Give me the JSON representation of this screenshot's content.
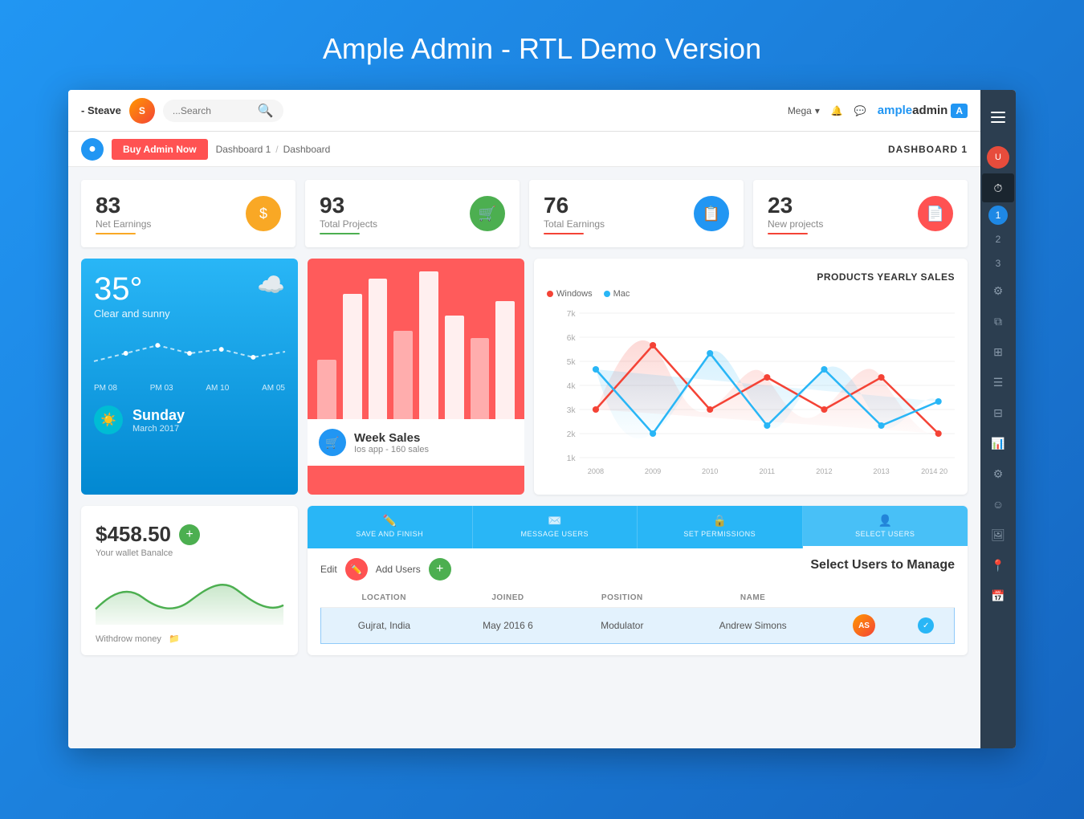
{
  "page": {
    "title": "Ample Admin - RTL Demo Version"
  },
  "header": {
    "brand": "- Steave",
    "search_placeholder": "...Search",
    "mega_label": "Mega",
    "logo_text_prefix": "ample",
    "logo_text_suffix": "admin"
  },
  "toolbar": {
    "buy_btn": "Buy Admin Now",
    "breadcrumb": [
      "Dashboard 1",
      "Dashboard"
    ],
    "dashboard_label": "DASHBOARD 1"
  },
  "stats": [
    {
      "number": "83",
      "label": "Net Earnings",
      "color": "#f9a825",
      "icon": "$",
      "underline": "#f9a825"
    },
    {
      "number": "93",
      "label": "Total Projects",
      "color": "#4caf50",
      "icon": "🛒",
      "underline": "#4caf50"
    },
    {
      "number": "76",
      "label": "Total Earnings",
      "color": "#2196F3",
      "icon": "📋",
      "underline": "#f44336"
    },
    {
      "number": "23",
      "label": "New projects",
      "color": "#ff5252",
      "icon": "📄",
      "underline": "#f44336"
    }
  ],
  "weather": {
    "temp": "35°",
    "icon": "☁️",
    "desc": "Clear and sunny",
    "times": [
      "PM 08",
      "PM 03",
      "AM 10",
      "AM 05"
    ],
    "day": "Sunday",
    "month": "March 2017"
  },
  "week_sales": {
    "title": "Week Sales",
    "subtitle": "Ios app - 160 sales",
    "bars": [
      40,
      75,
      85,
      60,
      90,
      65,
      55,
      80
    ]
  },
  "chart": {
    "title": "PRODUCTS YEARLY SALES",
    "legend": [
      {
        "label": "Windows",
        "color": "#f44336"
      },
      {
        "label": "Mac",
        "color": "#29b6f6"
      }
    ],
    "years": [
      "2008",
      "2009",
      "2010",
      "2011",
      "2012",
      "2013",
      "2014 20"
    ],
    "yaxis": [
      "7k",
      "6k",
      "5k",
      "4k",
      "3k",
      "2k",
      "1k"
    ]
  },
  "wallet": {
    "amount": "$458.50",
    "label": "Your wallet Banalce",
    "footer": "Withdrow money"
  },
  "users": {
    "tabs": [
      {
        "label": "SAVE AND FINISH",
        "icon": "✏️"
      },
      {
        "label": "MESSAGE USERS",
        "icon": "✉️"
      },
      {
        "label": "SET PERMISSIONS",
        "icon": "🔒"
      },
      {
        "label": "SELECT USERS",
        "icon": "👤"
      }
    ],
    "active_tab": 3,
    "actions": {
      "edit_label": "Edit",
      "add_label": "Add Users"
    },
    "select_title": "Select Users to Manage",
    "table_headers": [
      "LOCATION",
      "JOINED",
      "POSITION",
      "NAME"
    ],
    "rows": [
      {
        "location": "Gujrat, India",
        "joined": "May 2016 6",
        "position": "Modulator",
        "name": "Andrew Simons",
        "selected": true
      }
    ]
  }
}
